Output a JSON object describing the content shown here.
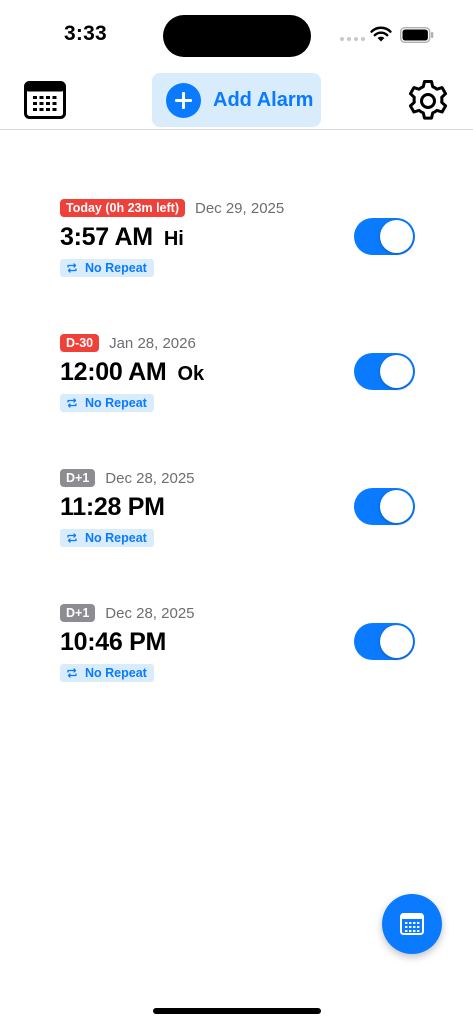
{
  "status_bar": {
    "time": "3:33"
  },
  "nav": {
    "calendar_icon": "calendar-grid-icon",
    "add_alarm_label": "Add Alarm",
    "settings_icon": "gear-icon"
  },
  "colors": {
    "accent": "#0a7aff",
    "accent_light": "#d9ecfb",
    "badge_red": "#f0403a",
    "badge_gray": "#8c8c91"
  },
  "alarms": [
    {
      "badge": "Today (0h 23m left)",
      "badge_color": "red",
      "date": "Dec 29, 2025",
      "time": "3:57 AM",
      "name": "Hi",
      "repeat": "No Repeat",
      "enabled": true
    },
    {
      "badge": "D-30",
      "badge_color": "red",
      "date": "Jan 28, 2026",
      "time": "12:00 AM",
      "name": "Ok",
      "repeat": "No Repeat",
      "enabled": true
    },
    {
      "badge": "D+1",
      "badge_color": "gray",
      "date": "Dec 28, 2025",
      "time": "11:28 PM",
      "name": "",
      "repeat": "No Repeat",
      "enabled": true
    },
    {
      "badge": "D+1",
      "badge_color": "gray",
      "date": "Dec 28, 2025",
      "time": "10:46 PM",
      "name": "",
      "repeat": "No Repeat",
      "enabled": true
    }
  ],
  "fab": {
    "icon": "calendar-icon"
  }
}
